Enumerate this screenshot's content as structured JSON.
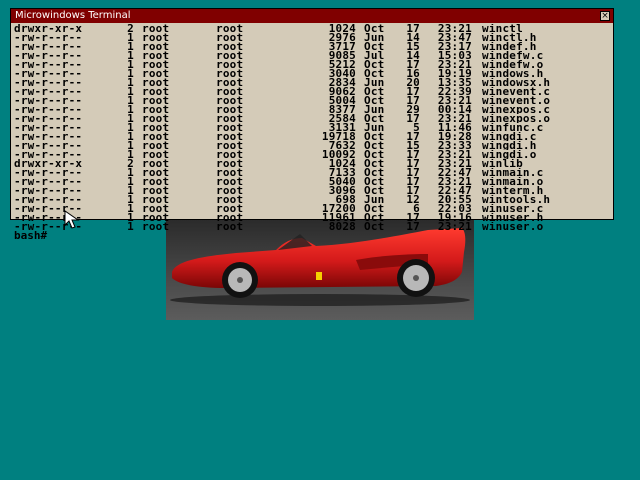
{
  "terminal": {
    "title": "Microwindows Terminal",
    "close_label": "×",
    "prompt": "bash#",
    "rows": [
      {
        "perm": "drwxr-xr-x",
        "links": "2",
        "owner": "root",
        "group": "root",
        "size": "1024",
        "month": "Oct",
        "day": "17",
        "time": "23:21",
        "name": "winctl"
      },
      {
        "perm": "-rw-r--r--",
        "links": "1",
        "owner": "root",
        "group": "root",
        "size": "2976",
        "month": "Jun",
        "day": "14",
        "time": "23:47",
        "name": "winctl.h"
      },
      {
        "perm": "-rw-r--r--",
        "links": "1",
        "owner": "root",
        "group": "root",
        "size": "3717",
        "month": "Oct",
        "day": "15",
        "time": "23:17",
        "name": "windef.h"
      },
      {
        "perm": "-rw-r--r--",
        "links": "1",
        "owner": "root",
        "group": "root",
        "size": "9085",
        "month": "Jul",
        "day": "14",
        "time": "15:03",
        "name": "windefw.c"
      },
      {
        "perm": "-rw-r--r--",
        "links": "1",
        "owner": "root",
        "group": "root",
        "size": "5212",
        "month": "Oct",
        "day": "17",
        "time": "23:21",
        "name": "windefw.o"
      },
      {
        "perm": "-rw-r--r--",
        "links": "1",
        "owner": "root",
        "group": "root",
        "size": "3040",
        "month": "Oct",
        "day": "16",
        "time": "19:19",
        "name": "windows.h"
      },
      {
        "perm": "-rw-r--r--",
        "links": "1",
        "owner": "root",
        "group": "root",
        "size": "2834",
        "month": "Jun",
        "day": "20",
        "time": "13:35",
        "name": "windowsx.h"
      },
      {
        "perm": "-rw-r--r--",
        "links": "1",
        "owner": "root",
        "group": "root",
        "size": "9062",
        "month": "Oct",
        "day": "17",
        "time": "22:39",
        "name": "winevent.c"
      },
      {
        "perm": "-rw-r--r--",
        "links": "1",
        "owner": "root",
        "group": "root",
        "size": "5004",
        "month": "Oct",
        "day": "17",
        "time": "23:21",
        "name": "winevent.o"
      },
      {
        "perm": "-rw-r--r--",
        "links": "1",
        "owner": "root",
        "group": "root",
        "size": "8377",
        "month": "Jun",
        "day": "29",
        "time": "00:14",
        "name": "winexpos.c"
      },
      {
        "perm": "-rw-r--r--",
        "links": "1",
        "owner": "root",
        "group": "root",
        "size": "2584",
        "month": "Oct",
        "day": "17",
        "time": "23:21",
        "name": "winexpos.o"
      },
      {
        "perm": "-rw-r--r--",
        "links": "1",
        "owner": "root",
        "group": "root",
        "size": "3131",
        "month": "Jun",
        "day": "5",
        "time": "11:46",
        "name": "winfunc.c"
      },
      {
        "perm": "-rw-r--r--",
        "links": "1",
        "owner": "root",
        "group": "root",
        "size": "19718",
        "month": "Oct",
        "day": "17",
        "time": "19:28",
        "name": "wingdi.c"
      },
      {
        "perm": "-rw-r--r--",
        "links": "1",
        "owner": "root",
        "group": "root",
        "size": "7632",
        "month": "Oct",
        "day": "15",
        "time": "23:33",
        "name": "wingdi.h"
      },
      {
        "perm": "-rw-r--r--",
        "links": "1",
        "owner": "root",
        "group": "root",
        "size": "10092",
        "month": "Oct",
        "day": "17",
        "time": "23:21",
        "name": "wingdi.o"
      },
      {
        "perm": "drwxr-xr-x",
        "links": "2",
        "owner": "root",
        "group": "root",
        "size": "1024",
        "month": "Oct",
        "day": "17",
        "time": "23:21",
        "name": "winlib"
      },
      {
        "perm": "-rw-r--r--",
        "links": "1",
        "owner": "root",
        "group": "root",
        "size": "7133",
        "month": "Oct",
        "day": "17",
        "time": "22:47",
        "name": "winmain.c"
      },
      {
        "perm": "-rw-r--r--",
        "links": "1",
        "owner": "root",
        "group": "root",
        "size": "5040",
        "month": "Oct",
        "day": "17",
        "time": "23:21",
        "name": "winmain.o"
      },
      {
        "perm": "-rw-r--r--",
        "links": "1",
        "owner": "root",
        "group": "root",
        "size": "3096",
        "month": "Oct",
        "day": "17",
        "time": "22:47",
        "name": "winterm.h"
      },
      {
        "perm": "-rw-r--r--",
        "links": "1",
        "owner": "root",
        "group": "root",
        "size": "698",
        "month": "Jun",
        "day": "12",
        "time": "20:55",
        "name": "wintools.h"
      },
      {
        "perm": "-rw-r--r--",
        "links": "1",
        "owner": "root",
        "group": "root",
        "size": "17200",
        "month": "Oct",
        "day": "6",
        "time": "22:03",
        "name": "winuser.c"
      },
      {
        "perm": "-rw-r--r--",
        "links": "1",
        "owner": "root",
        "group": "root",
        "size": "11961",
        "month": "Oct",
        "day": "17",
        "time": "19:16",
        "name": "winuser.h"
      },
      {
        "perm": "-rw-r--r--",
        "links": "1",
        "owner": "root",
        "group": "root",
        "size": "8028",
        "month": "Oct",
        "day": "17",
        "time": "23:21",
        "name": "winuser.o"
      }
    ]
  },
  "colors": {
    "desktop": "#008080",
    "titlebar": "#800000",
    "terminal_bg": "#d4cbb8",
    "car_body": "#d41a1a"
  },
  "icons": {
    "close": "close-icon",
    "cursor": "mouse-pointer-icon",
    "photo": "red-sports-car-image"
  }
}
